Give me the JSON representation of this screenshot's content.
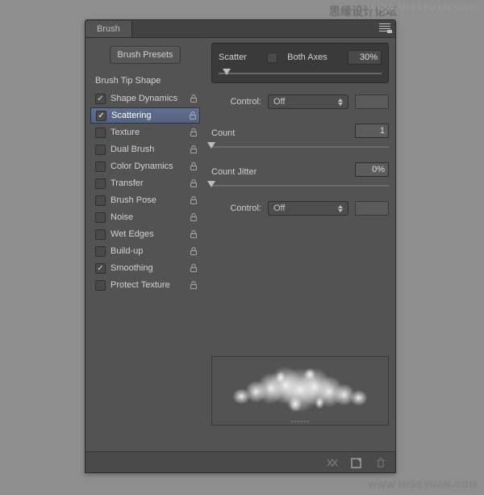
{
  "watermark": {
    "top_cn": "思缘设计论坛",
    "top_url": "WWW.MISSYUAN.COM",
    "bottom": "WWW.MISSYUAN.COM"
  },
  "panel": {
    "tab": "Brush",
    "presets_btn": "Brush Presets",
    "tip_shape": "Brush Tip Shape",
    "options": [
      {
        "label": "Shape Dynamics",
        "checked": true,
        "locked": true
      },
      {
        "label": "Scattering",
        "checked": true,
        "locked": true,
        "selected": true
      },
      {
        "label": "Texture",
        "checked": false,
        "locked": true
      },
      {
        "label": "Dual Brush",
        "checked": false,
        "locked": true
      },
      {
        "label": "Color Dynamics",
        "checked": false,
        "locked": true
      },
      {
        "label": "Transfer",
        "checked": false,
        "locked": true
      },
      {
        "label": "Brush Pose",
        "checked": false,
        "locked": true
      },
      {
        "label": "Noise",
        "checked": false,
        "locked": true
      },
      {
        "label": "Wet Edges",
        "checked": false,
        "locked": true
      },
      {
        "label": "Build-up",
        "checked": false,
        "locked": true
      },
      {
        "label": "Smoothing",
        "checked": true,
        "locked": true
      },
      {
        "label": "Protect Texture",
        "checked": false,
        "locked": true
      }
    ]
  },
  "settings": {
    "scatter": {
      "label": "Scatter",
      "both_axes": "Both Axes",
      "value": "30%",
      "slider_pct": 5,
      "control_label": "Control:",
      "control_value": "Off"
    },
    "count": {
      "label": "Count",
      "value": "1",
      "slider_pct": 0
    },
    "jitter": {
      "label": "Count Jitter",
      "value": "0%",
      "slider_pct": 0,
      "control_label": "Control:",
      "control_value": "Off"
    }
  },
  "footer": {
    "toggle": "toggle-preview-icon",
    "newdoc": "new-preset-icon",
    "trash": "delete-icon"
  }
}
